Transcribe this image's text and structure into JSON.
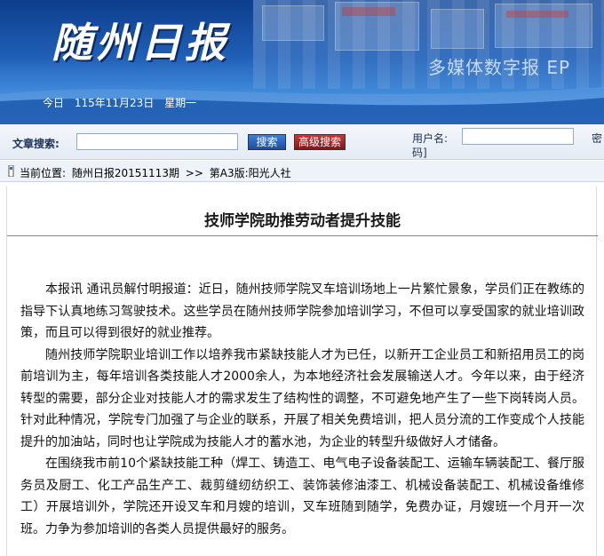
{
  "banner": {
    "logo": "随州日报",
    "subtitle": "多媒体数字报 EP",
    "date_today": "今日",
    "date_value": "115年11月23日",
    "weekday": "星期一"
  },
  "search": {
    "label": "文章搜索:",
    "keyword_value": "",
    "search_button": "搜索",
    "advanced_button": "高级搜索",
    "username_label": "用户名:",
    "password_label": "密",
    "password_label_tail": "码]"
  },
  "breadcrumb": {
    "prefix": "当前位置:",
    "issue": "随州日报20151113期",
    "separator": ">>",
    "page": "第A3版:阳光人社"
  },
  "article": {
    "title": "技师学院助推劳动者提升技能",
    "paragraphs": [
      "本报讯 通讯员解付明报道：近日，随州技师学院叉车培训场地上一片繁忙景象，学员们正在教练的指导下认真地练习驾驶技术。这些学员在随州技师学院参加培训学习，不但可以享受国家的就业培训政策，而且可以得到很好的就业推荐。",
      "随州技师学院职业培训工作以培养我市紧缺技能人才为已任，以新开工企业员工和新招用员工的岗前培训为主，每年培训各类技能人才2000余人，为本地经济社会发展输送人才。今年以来，由于经济转型的需要，部分企业对技能人才的需求发生了结构性的调整，不可避免地产生了一些下岗转岗人员。针对此种情况，学院专门加强了与企业的联系，开展了相关免费培训，把人员分流的工作变成个人技能提升的加油站，同时也让学院成为技能人才的蓄水池，为企业的转型升级做好人才储备。",
      "在围绕我市前10个紧缺技能工种（焊工、铸造工、电气电子设备装配工、运输车辆装配工、餐厅服务员及厨工、化工产品生产工、裁剪缝纫纺织工、装饰装修油漆工、机械设备装配工、机械设备维修工）开展培训外，学院还开设叉车和月嫂的培训，叉车班随到随学，免费办证，月嫂班一个月开一次班。力争为参加培训的各类人员提供最好的服务。"
    ]
  },
  "colors": {
    "banner_dark": "#0d3d8c",
    "banner_light": "#6aa9e6",
    "search_button": "#1b4fa0",
    "advanced_button": "#8a1414"
  }
}
